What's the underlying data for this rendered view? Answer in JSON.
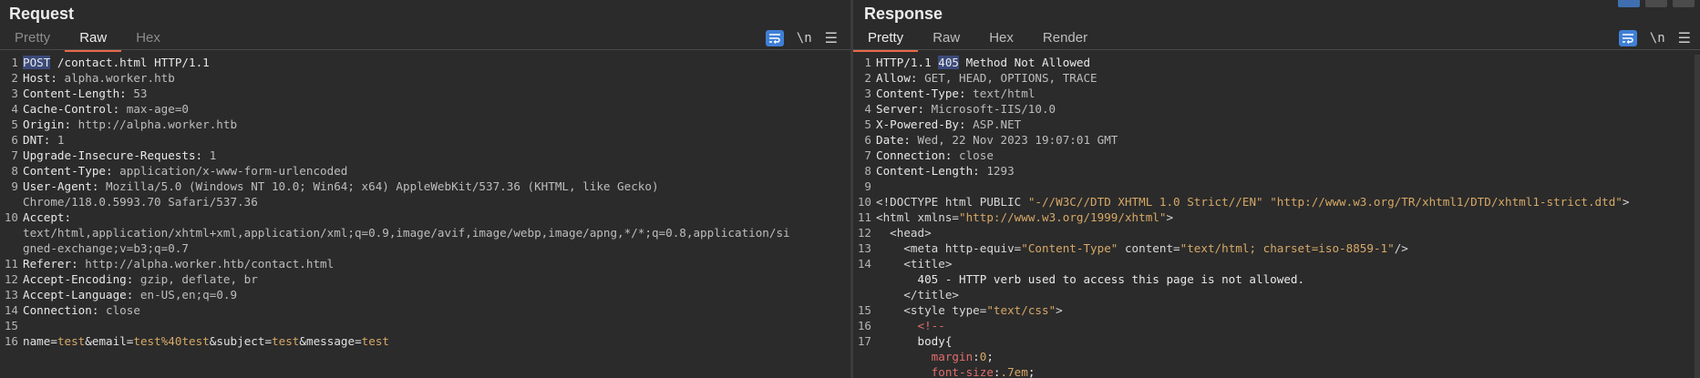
{
  "request": {
    "title": "Request",
    "tabs": [
      {
        "label": "Pretty"
      },
      {
        "label": "Raw"
      },
      {
        "label": "Hex"
      }
    ],
    "newline_label": "\\n",
    "line_numbers": [
      "1",
      "2",
      "3",
      "4",
      "5",
      "6",
      "7",
      "8",
      "9",
      "",
      "10",
      "",
      "",
      "11",
      "12",
      "13",
      "14",
      "15",
      "16"
    ],
    "lines": [
      {
        "method": "POST",
        "rest": " /contact.html HTTP/1.1"
      },
      {
        "k": "Host:",
        "v": " alpha.worker.htb"
      },
      {
        "k": "Content-Length:",
        "v": " 53"
      },
      {
        "k": "Cache-Control:",
        "v": " max-age=0"
      },
      {
        "k": "Origin:",
        "v": " http://alpha.worker.htb"
      },
      {
        "k": "DNT:",
        "v": " 1"
      },
      {
        "k": "Upgrade-Insecure-Requests:",
        "v": " 1"
      },
      {
        "k": "Content-Type:",
        "v": " application/x-www-form-urlencoded"
      },
      {
        "k": "User-Agent:",
        "v": " Mozilla/5.0 (Windows NT 10.0; Win64; x64) AppleWebKit/537.36 (KHTML, like Gecko)"
      },
      {
        "k": "",
        "v": "Chrome/118.0.5993.70 Safari/537.36"
      },
      {
        "k": "Accept:",
        "v": ""
      },
      {
        "k": "",
        "v": "text/html,application/xhtml+xml,application/xml;q=0.9,image/avif,image/webp,image/apng,*/*;q=0.8,application/si"
      },
      {
        "k": "",
        "v": "gned-exchange;v=b3;q=0.7"
      },
      {
        "k": "Referer:",
        "v": " http://alpha.worker.htb/contact.html"
      },
      {
        "k": "Accept-Encoding:",
        "v": " gzip, deflate, br"
      },
      {
        "k": "Accept-Language:",
        "v": " en-US,en;q=0.9"
      },
      {
        "k": "Connection:",
        "v": " close"
      },
      {
        "k": "",
        "v": ""
      },
      {
        "body": true
      }
    ],
    "body_params": [
      {
        "name": "name",
        "value": "test"
      },
      {
        "name": "email",
        "value": "test%40test"
      },
      {
        "name": "subject",
        "value": "test"
      },
      {
        "name": "message",
        "value": "test"
      }
    ]
  },
  "response": {
    "title": "Response",
    "tabs": [
      {
        "label": "Pretty"
      },
      {
        "label": "Raw"
      },
      {
        "label": "Hex"
      },
      {
        "label": "Render"
      }
    ],
    "newline_label": "\\n",
    "line_numbers": [
      "1",
      "2",
      "3",
      "4",
      "5",
      "6",
      "7",
      "8",
      "9",
      "10",
      "11",
      "12",
      "13",
      "14",
      "",
      "",
      "15",
      "16",
      "17",
      "",
      ""
    ],
    "status": {
      "proto": "HTTP/1.1 ",
      "code": "405",
      "text": " Method Not Allowed"
    },
    "headers": [
      {
        "k": "Allow:",
        "v": " GET, HEAD, OPTIONS, TRACE"
      },
      {
        "k": "Content-Type:",
        "v": " text/html"
      },
      {
        "k": "Server:",
        "v": " Microsoft-IIS/10.0"
      },
      {
        "k": "X-Powered-By:",
        "v": " ASP.NET"
      },
      {
        "k": "Date:",
        "v": " Wed, 22 Nov 2023 19:07:01 GMT"
      },
      {
        "k": "Connection:",
        "v": " close"
      },
      {
        "k": "Content-Length:",
        "v": " 1293"
      }
    ],
    "doctype": {
      "pre": "<!DOCTYPE html PUBLIC ",
      "a": "\"-//W3C//DTD XHTML 1.0 Strict//EN\"",
      "sp": " ",
      "b": "\"http://www.w3.org/TR/xhtml1/DTD/xhtml1-strict.dtd\"",
      "post": ">"
    },
    "html_open": {
      "pre": "<html ",
      "attr": "xmlns=",
      "val": "\"http://www.w3.org/1999/xhtml\"",
      "post": ">"
    },
    "head_open": "  <head>",
    "meta": {
      "pre": "    <meta ",
      "a1": "http-equiv=",
      "v1": "\"Content-Type\"",
      "a2": " content=",
      "v2": "\"text/html; charset=iso-8859-1\"",
      "post": "/>"
    },
    "title_open": "    <title>",
    "title_text": "      405 - HTTP verb used to access this page is not allowed.",
    "title_close": "    </title>",
    "style_open": {
      "pre": "    <style ",
      "attr": "type=",
      "val": "\"text/css\"",
      "post": ">"
    },
    "comment": "      <!--",
    "body_sel": "      body{",
    "css1": {
      "p": "        margin",
      "v": "0",
      "end": ";"
    },
    "css2": {
      "p": "        font-size",
      "v": ".7em",
      "end": ";"
    }
  }
}
